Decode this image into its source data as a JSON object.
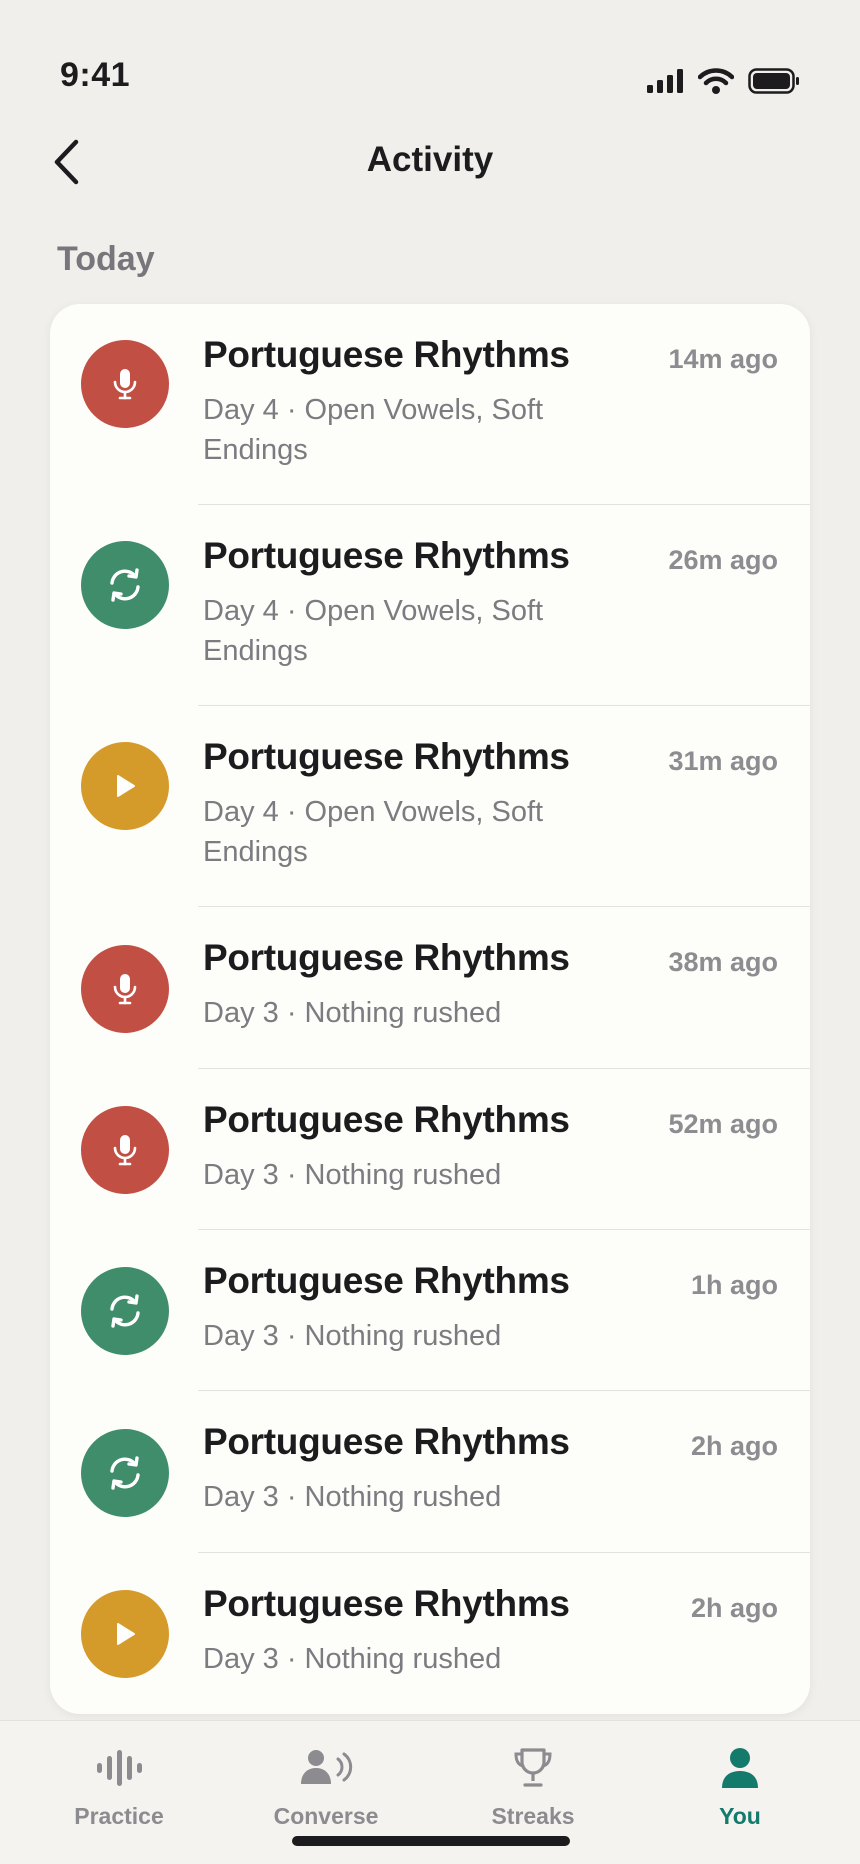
{
  "status_bar": {
    "time": "9:41"
  },
  "header": {
    "title": "Activity"
  },
  "section": {
    "label": "Today"
  },
  "colors": {
    "red": "#c24f44",
    "green": "#3f8d6b",
    "yellow": "#d49a2a",
    "accent": "#137a6c"
  },
  "activities": [
    {
      "icon": "microphone-icon",
      "color": "red",
      "title": "Portuguese Rhythms",
      "subtitle": "Day 4 · Open Vowels, Soft Endings",
      "time": "14m ago"
    },
    {
      "icon": "repeat-icon",
      "color": "green",
      "title": "Portuguese Rhythms",
      "subtitle": "Day 4 · Open Vowels, Soft Endings",
      "time": "26m ago"
    },
    {
      "icon": "play-icon",
      "color": "yellow",
      "title": "Portuguese Rhythms",
      "subtitle": "Day 4 · Open Vowels, Soft Endings",
      "time": "31m ago"
    },
    {
      "icon": "microphone-icon",
      "color": "red",
      "title": "Portuguese Rhythms",
      "subtitle": "Day 3 · Nothing rushed",
      "time": "38m ago"
    },
    {
      "icon": "microphone-icon",
      "color": "red",
      "title": "Portuguese Rhythms",
      "subtitle": "Day 3 · Nothing rushed",
      "time": "52m ago"
    },
    {
      "icon": "repeat-icon",
      "color": "green",
      "title": "Portuguese Rhythms",
      "subtitle": "Day 3 · Nothing rushed",
      "time": "1h ago"
    },
    {
      "icon": "repeat-icon",
      "color": "green",
      "title": "Portuguese Rhythms",
      "subtitle": "Day 3 · Nothing rushed",
      "time": "2h ago"
    },
    {
      "icon": "play-icon",
      "color": "yellow",
      "title": "Portuguese Rhythms",
      "subtitle": "Day 3 · Nothing rushed",
      "time": "2h ago"
    }
  ],
  "tabs": [
    {
      "label": "Practice",
      "icon": "waveform-icon",
      "active": false
    },
    {
      "label": "Converse",
      "icon": "person-speaking-icon",
      "active": false
    },
    {
      "label": "Streaks",
      "icon": "trophy-icon",
      "active": false
    },
    {
      "label": "You",
      "icon": "person-icon",
      "active": true
    }
  ]
}
